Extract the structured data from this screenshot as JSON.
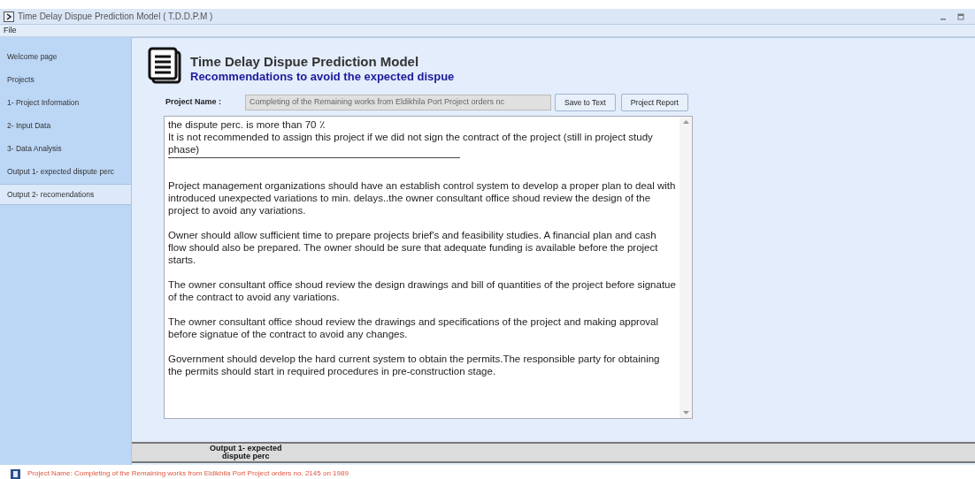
{
  "window": {
    "title": "Time Delay Dispue Prediction Model ( T.D.D.P.M )"
  },
  "menu": [
    "File"
  ],
  "sidebar": {
    "items": [
      {
        "label": "Welcome page",
        "selected": false
      },
      {
        "label": "Projects",
        "selected": false
      },
      {
        "label": "1- Project Information",
        "selected": false
      },
      {
        "label": "2- Input Data",
        "selected": false
      },
      {
        "label": "3- Data Analysis",
        "selected": false
      },
      {
        "label": "Output 1- expected dispute perc",
        "selected": false
      },
      {
        "label": "Output 2- recomendations",
        "selected": true
      }
    ]
  },
  "header": {
    "title": "Time Delay Dispue Prediction Model",
    "subtitle": "Recommendations to avoid  the expected dispue"
  },
  "project_name": {
    "label": "Project Name :",
    "value": "Completing of the Remaining works from Eldikhila Port Project orders nc"
  },
  "buttons": [
    "Save to Text",
    "Project Report"
  ],
  "recommendations": [
    {
      "kind": "text",
      "text": "the dispute perc. is more than 70 ٪\nIt is not recommended to assign this project if we did not sign the contract of the project (still in project study phase)"
    },
    {
      "kind": "rule"
    },
    {
      "kind": "text",
      "text": "Project management organizations should have an establish control system to develop a proper plan to deal with introduced unexpected variations to min. delays..the owner consultant office shoud review the design of the project to avoid any variations."
    },
    {
      "kind": "text",
      "text": "Owner should allow sufficient time to prepare projects brief's and feasibility studies. A financial plan and cash flow should also be prepared. The owner should be sure that adequate funding is available before the project starts."
    },
    {
      "kind": "text",
      "text": "The owner consultant office shoud review the design drawings and bill of quantities of the project before signatue of the contract to avoid any variations."
    },
    {
      "kind": "text",
      "text": "The owner consultant office shoud review the drawings and specifications of the project and making approval  before signatue of the contract to avoid any changes."
    },
    {
      "kind": "text",
      "text": "Government should develop the hard current system to obtain the permits.The responsible party for obtaining the permits should start in required procedures in pre-construction stage."
    }
  ],
  "bottom_tab": "Output 1- expected\ndispute perc",
  "status_bar": "Project Name: Completing of the Remaining works from Eldikhila Port Project orders no. 2145 on 1989"
}
